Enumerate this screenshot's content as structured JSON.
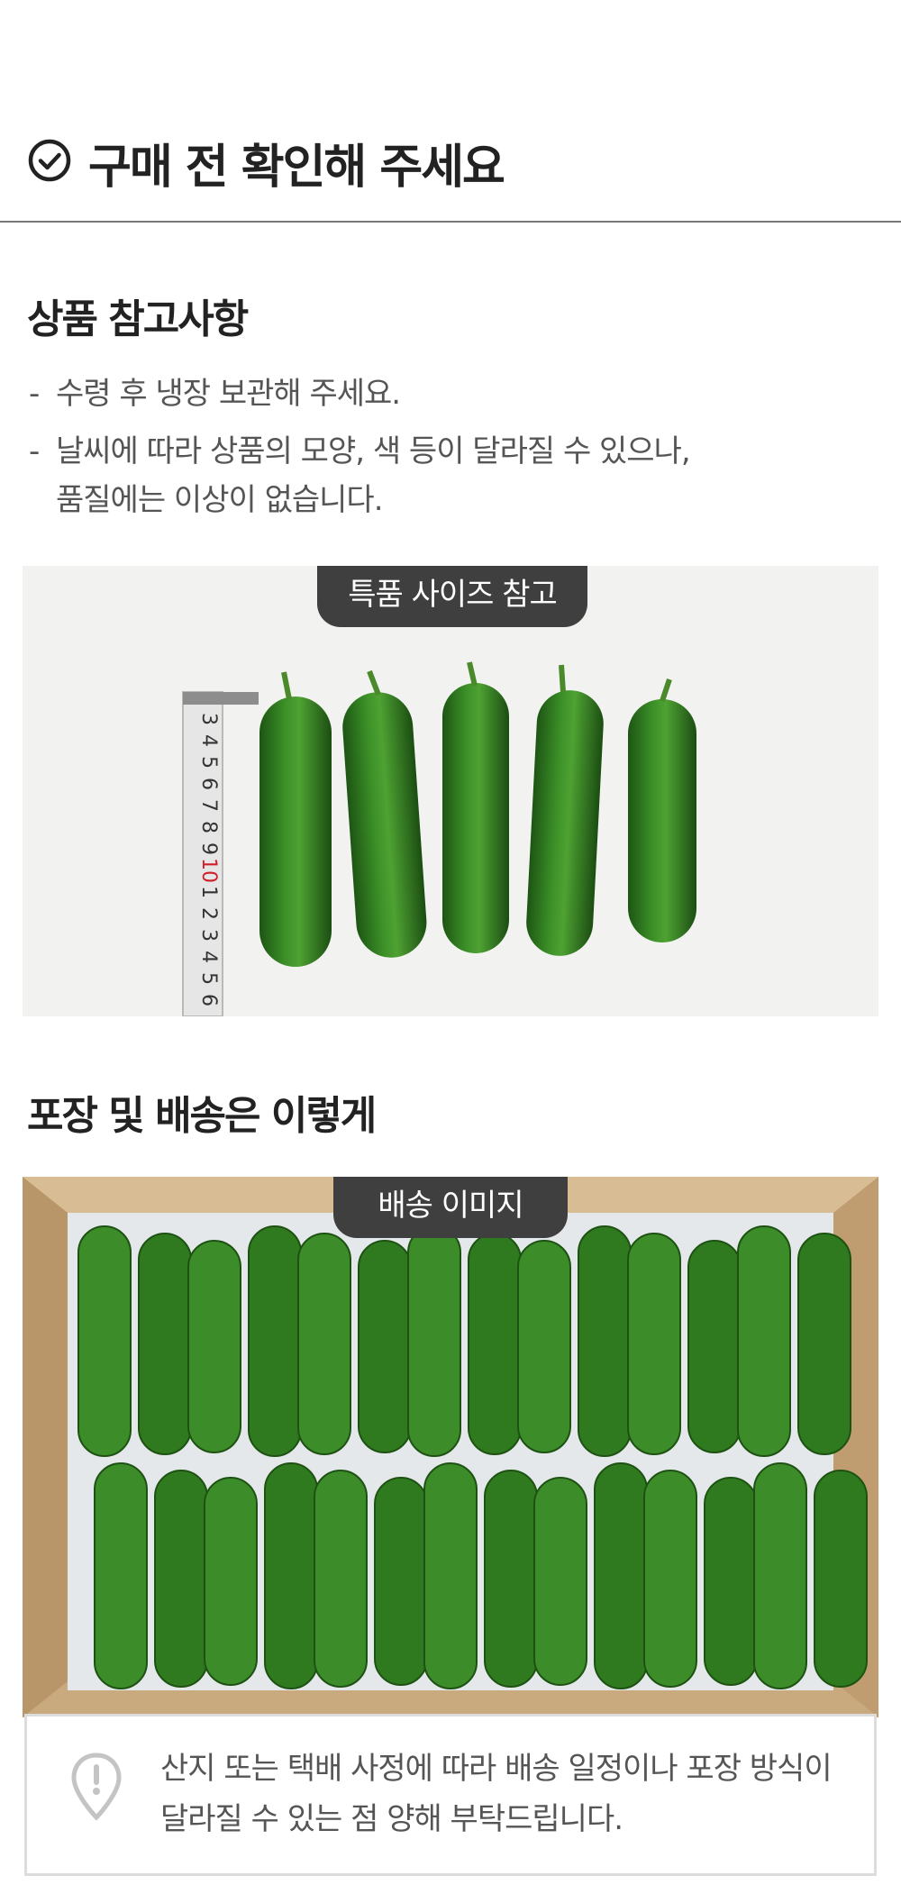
{
  "header": {
    "icon": "check-circle-icon",
    "title": "구매 전 확인해 주세요"
  },
  "product_notes": {
    "title": "상품 참고사항",
    "items": [
      "수령 후 냉장 보관해 주세요.",
      "날씨에 따라 상품의 모양, 색 등이 달라질 수 있으나,",
      "품질에는 이상이 없습니다."
    ]
  },
  "size_photo": {
    "badge": "특품 사이즈 참고",
    "ruler_numbers": [
      "3",
      "4",
      "5",
      "6",
      "7",
      "8",
      "9",
      "10",
      "1",
      "2",
      "3",
      "4",
      "5",
      "6"
    ]
  },
  "shipping": {
    "title": "포장 및 배송은 이렇게",
    "badge": "배송 이미지"
  },
  "notice": {
    "icon": "alert-pin-icon",
    "line1": "산지 또는 택배 사정에 따라 배송 일정이나 포장 방식이",
    "line2": "달라질 수 있는 점 양해 부탁드립니다."
  },
  "colors": {
    "badge_bg": "#3f3f3f",
    "cucumber": "#2f7a1f",
    "box": "#c9a97e"
  }
}
